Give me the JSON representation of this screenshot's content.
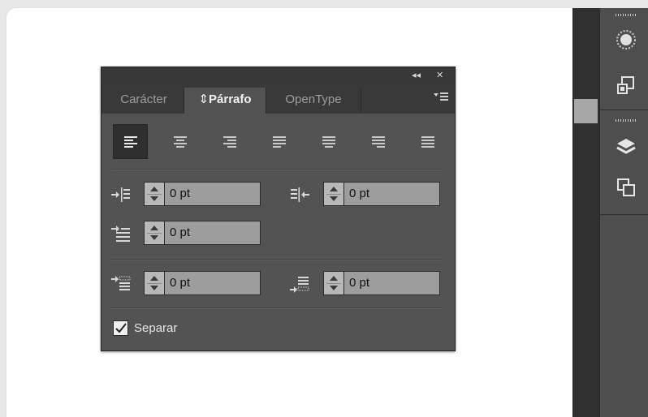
{
  "panel": {
    "tabs": [
      {
        "label": "Carácter",
        "active": false
      },
      {
        "label": "Párrafo",
        "active": true,
        "prefix_icon": "up-down-chevron-icon"
      },
      {
        "label": "OpenType",
        "active": false
      }
    ],
    "top_controls": {
      "collapse": "◂◂",
      "close": "✕"
    },
    "menu_icon": "panel-menu-icon",
    "alignment_buttons": [
      {
        "name": "align-left",
        "selected": true
      },
      {
        "name": "align-center",
        "selected": false
      },
      {
        "name": "align-right",
        "selected": false
      },
      {
        "name": "justify-last-left",
        "selected": false
      },
      {
        "name": "justify-last-center",
        "selected": false
      },
      {
        "name": "justify-last-right",
        "selected": false
      },
      {
        "name": "justify-all",
        "selected": false
      }
    ],
    "fields": {
      "left_indent": "0 pt",
      "right_indent": "0 pt",
      "first_line_indent": "0 pt",
      "space_before": "0 pt",
      "space_after": "0 pt"
    },
    "hyphenate": {
      "label": "Separar",
      "checked": true
    }
  },
  "colors": {
    "panel_bg": "#535353",
    "tab_bar_bg": "#393939",
    "field_bg": "#9d9d9d",
    "dock_bg": "#4e4e4e"
  },
  "dock_icons": [
    "color-wheel-icon",
    "artboard-export-icon",
    "layers-icon",
    "transform-icon"
  ]
}
